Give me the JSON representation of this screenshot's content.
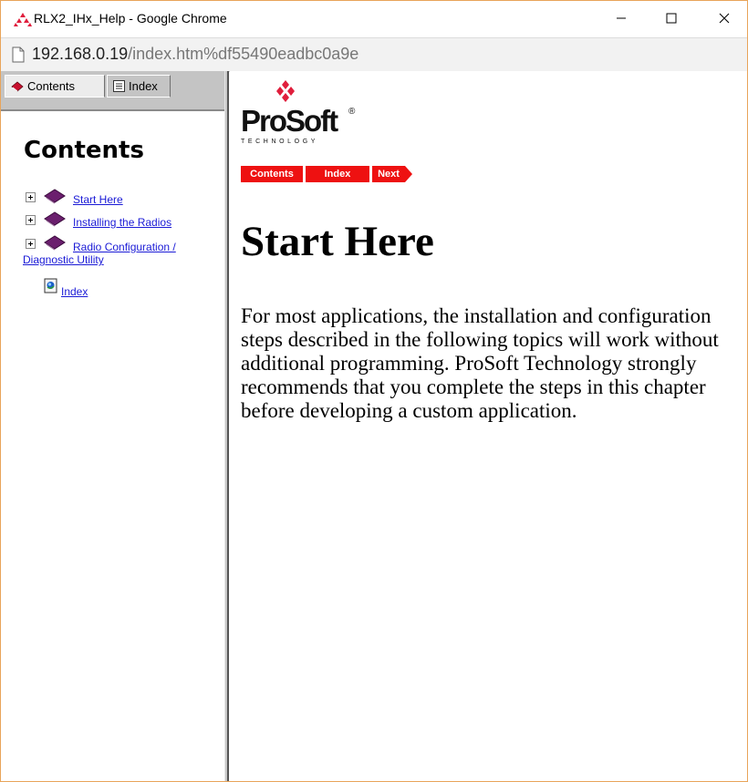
{
  "window": {
    "title": "RLX2_IHx_Help - Google Chrome"
  },
  "address_bar": {
    "host": "192.168.0.19",
    "path": "/index.htm%df55490eadbc0a9e"
  },
  "left_pane": {
    "tabs": [
      {
        "label": "Contents",
        "icon": "book-icon"
      },
      {
        "label": "Index",
        "icon": "index-list-icon"
      }
    ],
    "heading": "Contents",
    "toc": [
      {
        "label": "Start Here",
        "icon": "book-icon",
        "expandable": true
      },
      {
        "label": "Installing the Radios",
        "icon": "book-icon",
        "expandable": true
      },
      {
        "label_line1": "Radio Configuration /",
        "label_line2": "Diagnostic Utility",
        "icon": "book-icon",
        "expandable": true
      },
      {
        "label": "Index",
        "icon": "help-page-icon",
        "expandable": false
      }
    ]
  },
  "right_pane": {
    "logo": {
      "name": "ProSoft",
      "tagline": "TECHNOLOGY",
      "mark": "®"
    },
    "nav_buttons": [
      "Contents",
      "Index",
      "Next"
    ],
    "heading": "Start Here",
    "paragraph": "For most applications, the installation and configuration steps described in the following topics will work without additional programming. ProSoft Technology strongly recommends that you complete the steps in this chapter before developing a custom application."
  },
  "colors": {
    "window_border": "#e8a45a",
    "link": "#1a1ad6",
    "nav_red": "#ee1111",
    "logo_red": "#e01e3c",
    "book_purple": "#6b1f6e"
  }
}
